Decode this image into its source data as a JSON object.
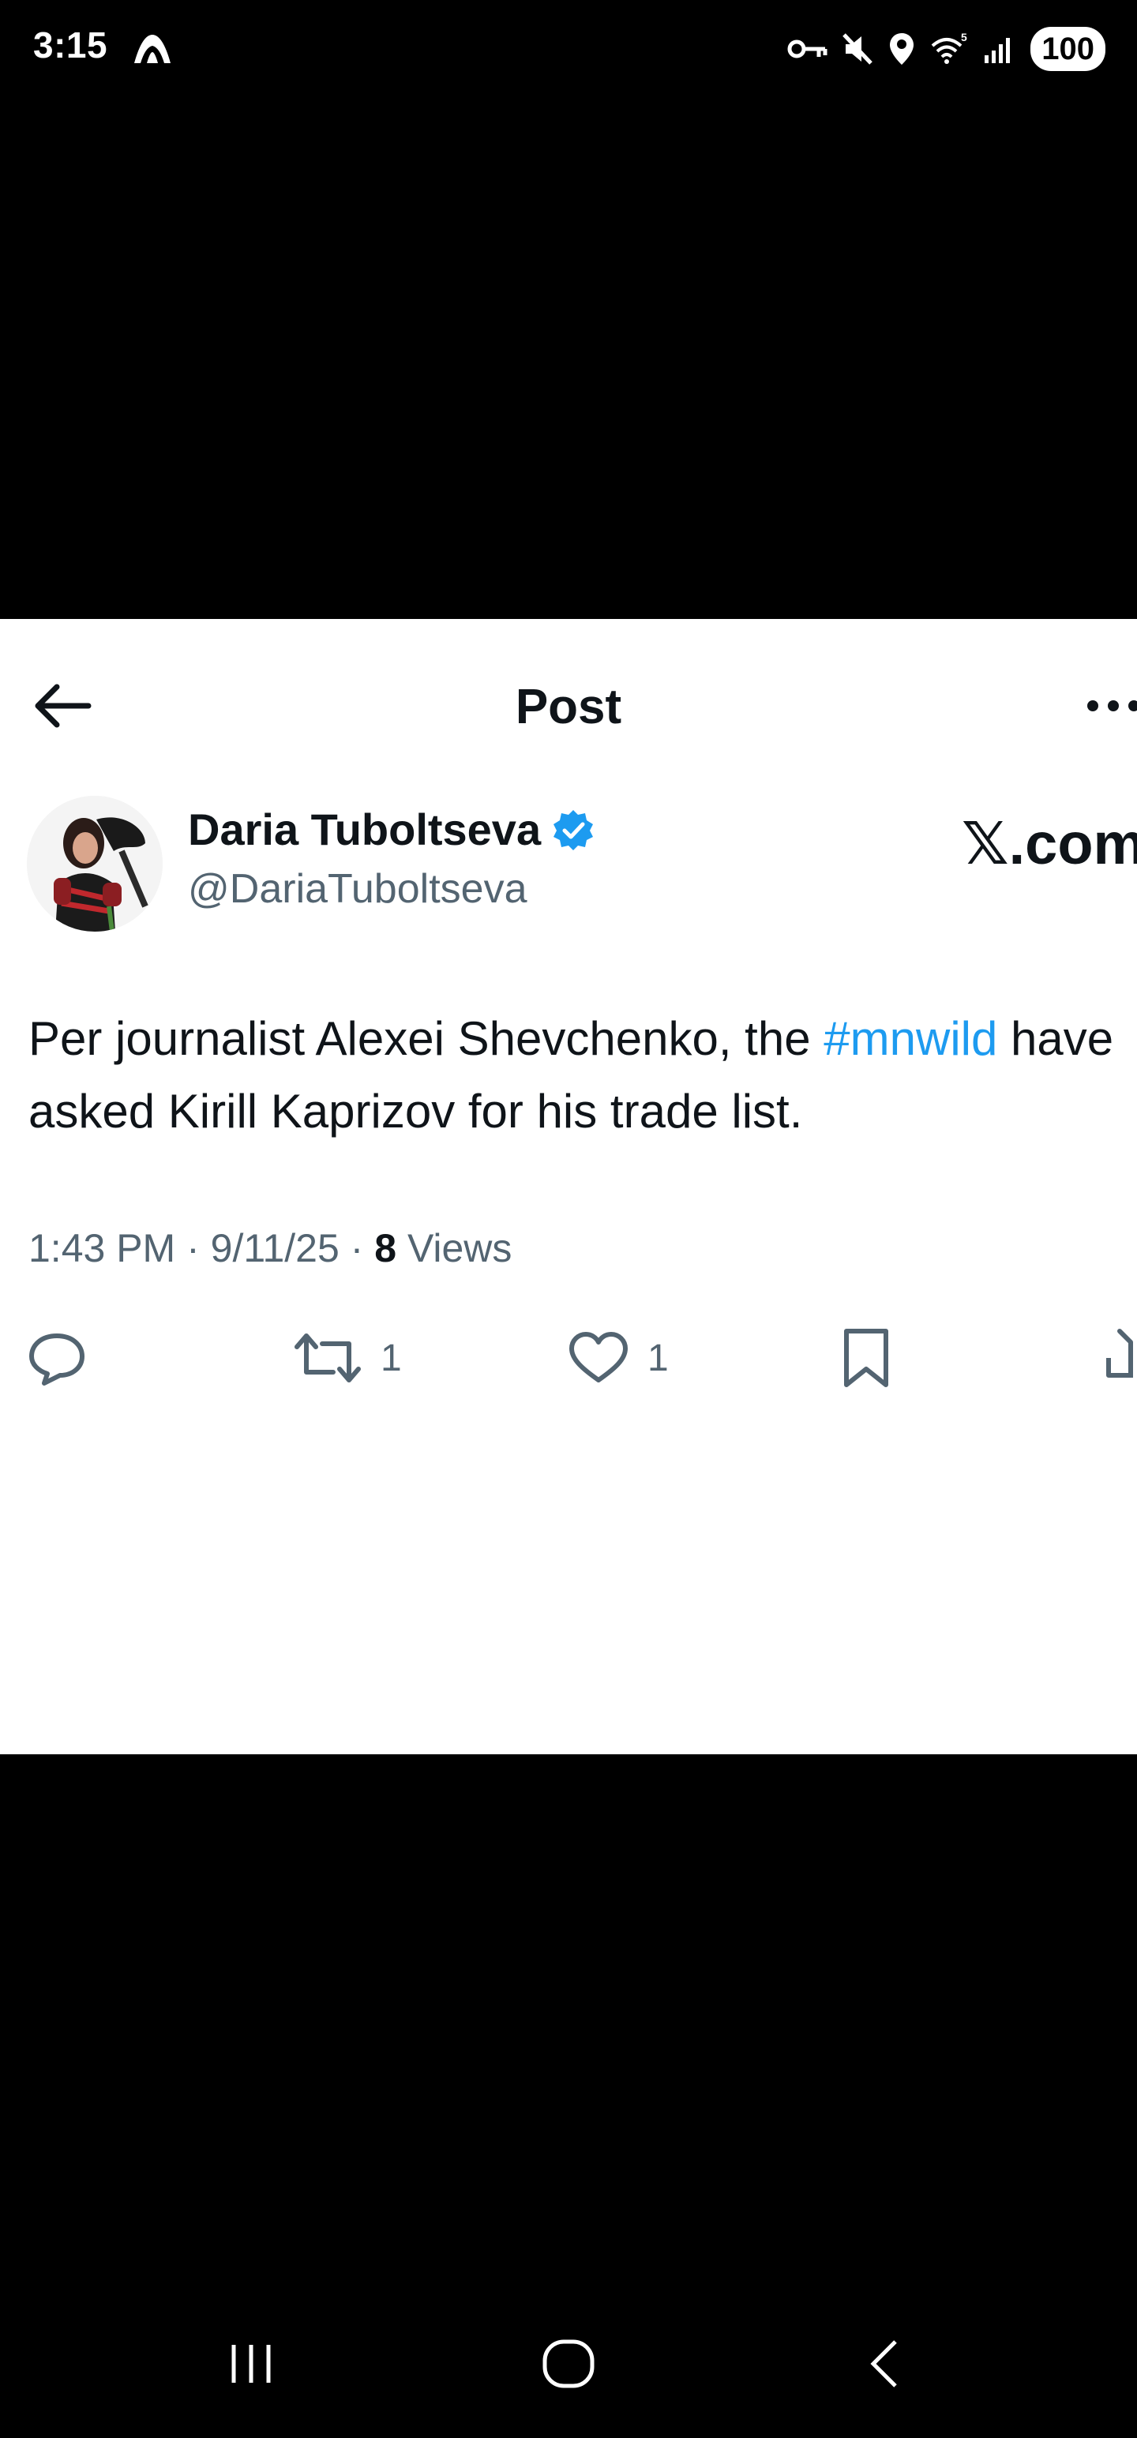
{
  "status_bar": {
    "time": "3:15",
    "battery": "100",
    "icons": [
      "app-icon",
      "vpn-key-icon",
      "mute-icon",
      "location-icon",
      "wifi-icon",
      "signal-icon"
    ]
  },
  "header": {
    "title": "Post"
  },
  "tweet": {
    "author_name": "Daria Tuboltseva",
    "handle": "@DariaTuboltseva",
    "verified": true,
    "watermark": "𝕏.com",
    "text_before": "Per journalist Alexei Shevchenko, the ",
    "hashtag": "#mnwild",
    "text_after": " have asked Kirill Kaprizov for his trade list.",
    "time": "1:43 PM",
    "date": "9/11/25",
    "views_count": "8",
    "views_label": "Views",
    "separator": " · ",
    "retweets": "1",
    "likes": "1"
  },
  "colors": {
    "accent": "#1d9bf0",
    "text": "#0f1419",
    "muted": "#536471"
  }
}
